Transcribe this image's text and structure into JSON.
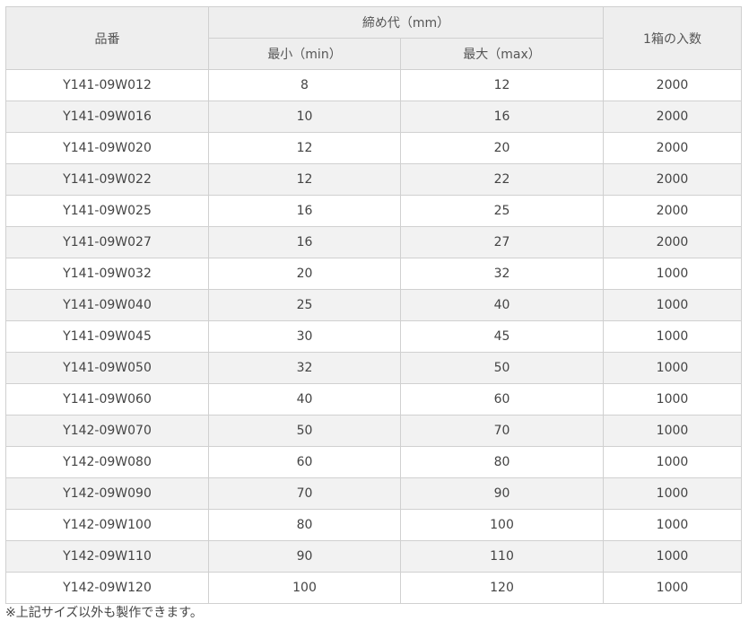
{
  "table": {
    "headers": {
      "part_number": "品番",
      "range_group": "締め代（mm）",
      "min": "最小（min）",
      "max": "最大（max）",
      "qty_per_box": "1箱の入数"
    },
    "rows": [
      {
        "part": "Y141-09W012",
        "min": "8",
        "max": "12",
        "qty": "2000"
      },
      {
        "part": "Y141-09W016",
        "min": "10",
        "max": "16",
        "qty": "2000"
      },
      {
        "part": "Y141-09W020",
        "min": "12",
        "max": "20",
        "qty": "2000"
      },
      {
        "part": "Y141-09W022",
        "min": "12",
        "max": "22",
        "qty": "2000"
      },
      {
        "part": "Y141-09W025",
        "min": "16",
        "max": "25",
        "qty": "2000"
      },
      {
        "part": "Y141-09W027",
        "min": "16",
        "max": "27",
        "qty": "2000"
      },
      {
        "part": "Y141-09W032",
        "min": "20",
        "max": "32",
        "qty": "1000"
      },
      {
        "part": "Y141-09W040",
        "min": "25",
        "max": "40",
        "qty": "1000"
      },
      {
        "part": "Y141-09W045",
        "min": "30",
        "max": "45",
        "qty": "1000"
      },
      {
        "part": "Y141-09W050",
        "min": "32",
        "max": "50",
        "qty": "1000"
      },
      {
        "part": "Y141-09W060",
        "min": "40",
        "max": "60",
        "qty": "1000"
      },
      {
        "part": "Y142-09W070",
        "min": "50",
        "max": "70",
        "qty": "1000"
      },
      {
        "part": "Y142-09W080",
        "min": "60",
        "max": "80",
        "qty": "1000"
      },
      {
        "part": "Y142-09W090",
        "min": "70",
        "max": "90",
        "qty": "1000"
      },
      {
        "part": "Y142-09W100",
        "min": "80",
        "max": "100",
        "qty": "1000"
      },
      {
        "part": "Y142-09W110",
        "min": "90",
        "max": "110",
        "qty": "1000"
      },
      {
        "part": "Y142-09W120",
        "min": "100",
        "max": "120",
        "qty": "1000"
      }
    ]
  },
  "note": "※上記サイズ以外も製作できます。",
  "colors": {
    "header_bg": "#eeeeee",
    "stripe_bg": "#f2f2f2",
    "border": "#d0d0d0",
    "text": "#444444"
  }
}
